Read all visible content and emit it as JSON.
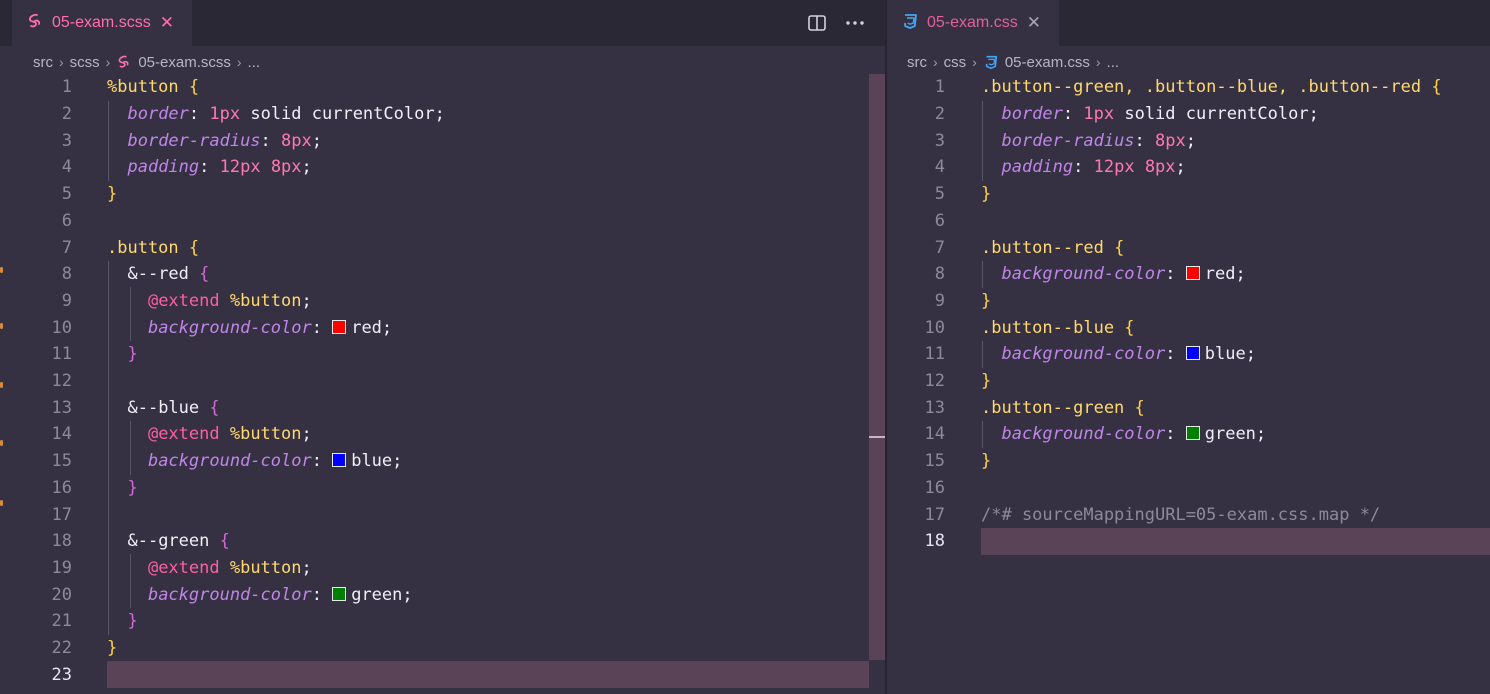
{
  "left": {
    "tab": {
      "filename": "05-exam.scss",
      "close": "✕"
    },
    "breadcrumb": {
      "segments": [
        "src",
        "scss"
      ],
      "file": "05-exam.scss",
      "more": "..."
    },
    "actions": {
      "split_icon": "split-editor-icon",
      "more_icon": "more-actions-icon"
    },
    "code": {
      "l1": {
        "n": "1",
        "a": "%button",
        "b": " {"
      },
      "l2": {
        "n": "2",
        "prop": "border",
        "colon": ": ",
        "num": "1px",
        "rest": " solid currentColor;"
      },
      "l3": {
        "n": "3",
        "prop": "border-radius",
        "colon": ": ",
        "num": "8px",
        "rest": ";"
      },
      "l4": {
        "n": "4",
        "prop": "padding",
        "colon": ": ",
        "num": "12px",
        "num2": " 8px",
        "rest": ";"
      },
      "l5": {
        "n": "5",
        "a": "}"
      },
      "l6": {
        "n": "6"
      },
      "l7": {
        "n": "7",
        "a": ".button",
        "b": " {"
      },
      "l8": {
        "n": "8",
        "amp": "&--red",
        "b": " {"
      },
      "l9": {
        "n": "9",
        "at": "@extend",
        "sel": " %button",
        "rest": ";"
      },
      "l10": {
        "n": "10",
        "prop": "background-color",
        "colon": ": ",
        "color": "#ff0000",
        "val": "red",
        "rest": ";"
      },
      "l11": {
        "n": "11",
        "a": "}"
      },
      "l12": {
        "n": "12"
      },
      "l13": {
        "n": "13",
        "amp": "&--blue",
        "b": " {"
      },
      "l14": {
        "n": "14",
        "at": "@extend",
        "sel": " %button",
        "rest": ";"
      },
      "l15": {
        "n": "15",
        "prop": "background-color",
        "colon": ": ",
        "color": "#0000ff",
        "val": "blue",
        "rest": ";"
      },
      "l16": {
        "n": "16",
        "a": "}"
      },
      "l17": {
        "n": "17"
      },
      "l18": {
        "n": "18",
        "amp": "&--green",
        "b": " {"
      },
      "l19": {
        "n": "19",
        "at": "@extend",
        "sel": " %button",
        "rest": ";"
      },
      "l20": {
        "n": "20",
        "prop": "background-color",
        "colon": ": ",
        "color": "#008000",
        "val": "green",
        "rest": ";"
      },
      "l21": {
        "n": "21",
        "a": "}"
      },
      "l22": {
        "n": "22",
        "a": "}"
      },
      "l23": {
        "n": "23"
      }
    }
  },
  "right": {
    "tab": {
      "filename": "05-exam.css",
      "close": "✕"
    },
    "breadcrumb": {
      "segments": [
        "src",
        "css"
      ],
      "file": "05-exam.css",
      "more": "..."
    },
    "code": {
      "l1": {
        "n": "1",
        "a": ".button--green, .button--blue, .button--red",
        "b": " {"
      },
      "l2": {
        "n": "2",
        "prop": "border",
        "colon": ": ",
        "num": "1px",
        "rest": " solid currentColor;"
      },
      "l3": {
        "n": "3",
        "prop": "border-radius",
        "colon": ": ",
        "num": "8px",
        "rest": ";"
      },
      "l4": {
        "n": "4",
        "prop": "padding",
        "colon": ": ",
        "num": "12px",
        "num2": " 8px",
        "rest": ";"
      },
      "l5": {
        "n": "5",
        "a": "}"
      },
      "l6": {
        "n": "6"
      },
      "l7": {
        "n": "7",
        "a": ".button--red",
        "b": " {"
      },
      "l8": {
        "n": "8",
        "prop": "background-color",
        "colon": ": ",
        "color": "#ff0000",
        "val": "red",
        "rest": ";"
      },
      "l9": {
        "n": "9",
        "a": "}"
      },
      "l10": {
        "n": "10",
        "a": ".button--blue",
        "b": " {"
      },
      "l11": {
        "n": "11",
        "prop": "background-color",
        "colon": ": ",
        "color": "#0000ff",
        "val": "blue",
        "rest": ";"
      },
      "l12": {
        "n": "12",
        "a": "}"
      },
      "l13": {
        "n": "13",
        "a": ".button--green",
        "b": " {"
      },
      "l14": {
        "n": "14",
        "prop": "background-color",
        "colon": ": ",
        "color": "#008000",
        "val": "green",
        "rest": ";"
      },
      "l15": {
        "n": "15",
        "a": "}"
      },
      "l16": {
        "n": "16"
      },
      "l17": {
        "n": "17",
        "comment": "/*# sourceMappingURL=05-exam.css.map */"
      },
      "l18": {
        "n": "18"
      }
    }
  }
}
